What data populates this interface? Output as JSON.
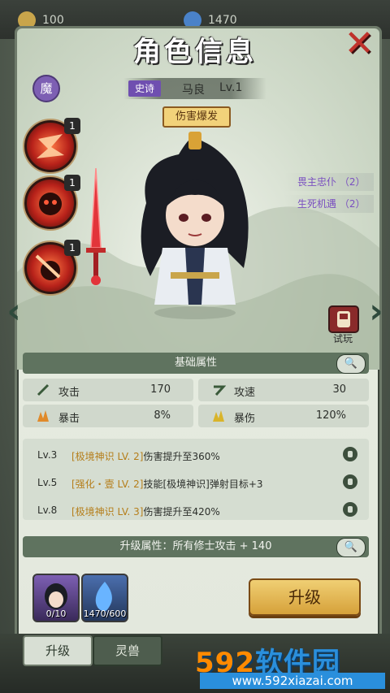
{
  "topbar": {
    "currency1": "100",
    "currency2": "1470"
  },
  "header": {
    "title": "角色信息"
  },
  "hero": {
    "faction_glyph": "魔",
    "rarity": "史诗",
    "name": "马良",
    "level": "Lv.1",
    "skill_tag": "伤害爆发"
  },
  "skills": [
    {
      "count": "1"
    },
    {
      "count": "1"
    },
    {
      "count": "1"
    }
  ],
  "traits": [
    "畏主忠仆 （2）",
    "生死机遇 （2）"
  ],
  "trial_label": "试玩",
  "base_attributes": {
    "title": "基础属性",
    "stats": [
      {
        "label": "攻击",
        "value": "170"
      },
      {
        "label": "攻速",
        "value": "30"
      },
      {
        "label": "暴击",
        "value": "8%"
      },
      {
        "label": "暴伤",
        "value": "120%"
      }
    ]
  },
  "passives": [
    {
      "lv": "Lv.3",
      "tag": "[极境神识 LV. 2]",
      "text": "伤害提升至360%"
    },
    {
      "lv": "Lv.5",
      "tag": "[强化・壹 LV. 2]",
      "text": "技能[极境神识]弹射目标+3"
    },
    {
      "lv": "Lv.8",
      "tag": "[极境神识 LV. 3]",
      "text": "伤害提升至420%"
    }
  ],
  "upgrade_attr": "升级属性：所有修士攻击 + 140",
  "items": {
    "shards": "0/10",
    "essence": "1470/600"
  },
  "upgrade_button": "升级",
  "tabs": {
    "upgrade": "升级",
    "spirit_beast": "灵兽"
  },
  "watermark": {
    "brand_num": "592",
    "brand_text": "软件园",
    "url": "www.592xiazai.com"
  },
  "colors": {
    "accent": "#5f735f",
    "highlight": "#b57e1a",
    "rarity": "#6f4fb0",
    "close": "#c0322b"
  }
}
